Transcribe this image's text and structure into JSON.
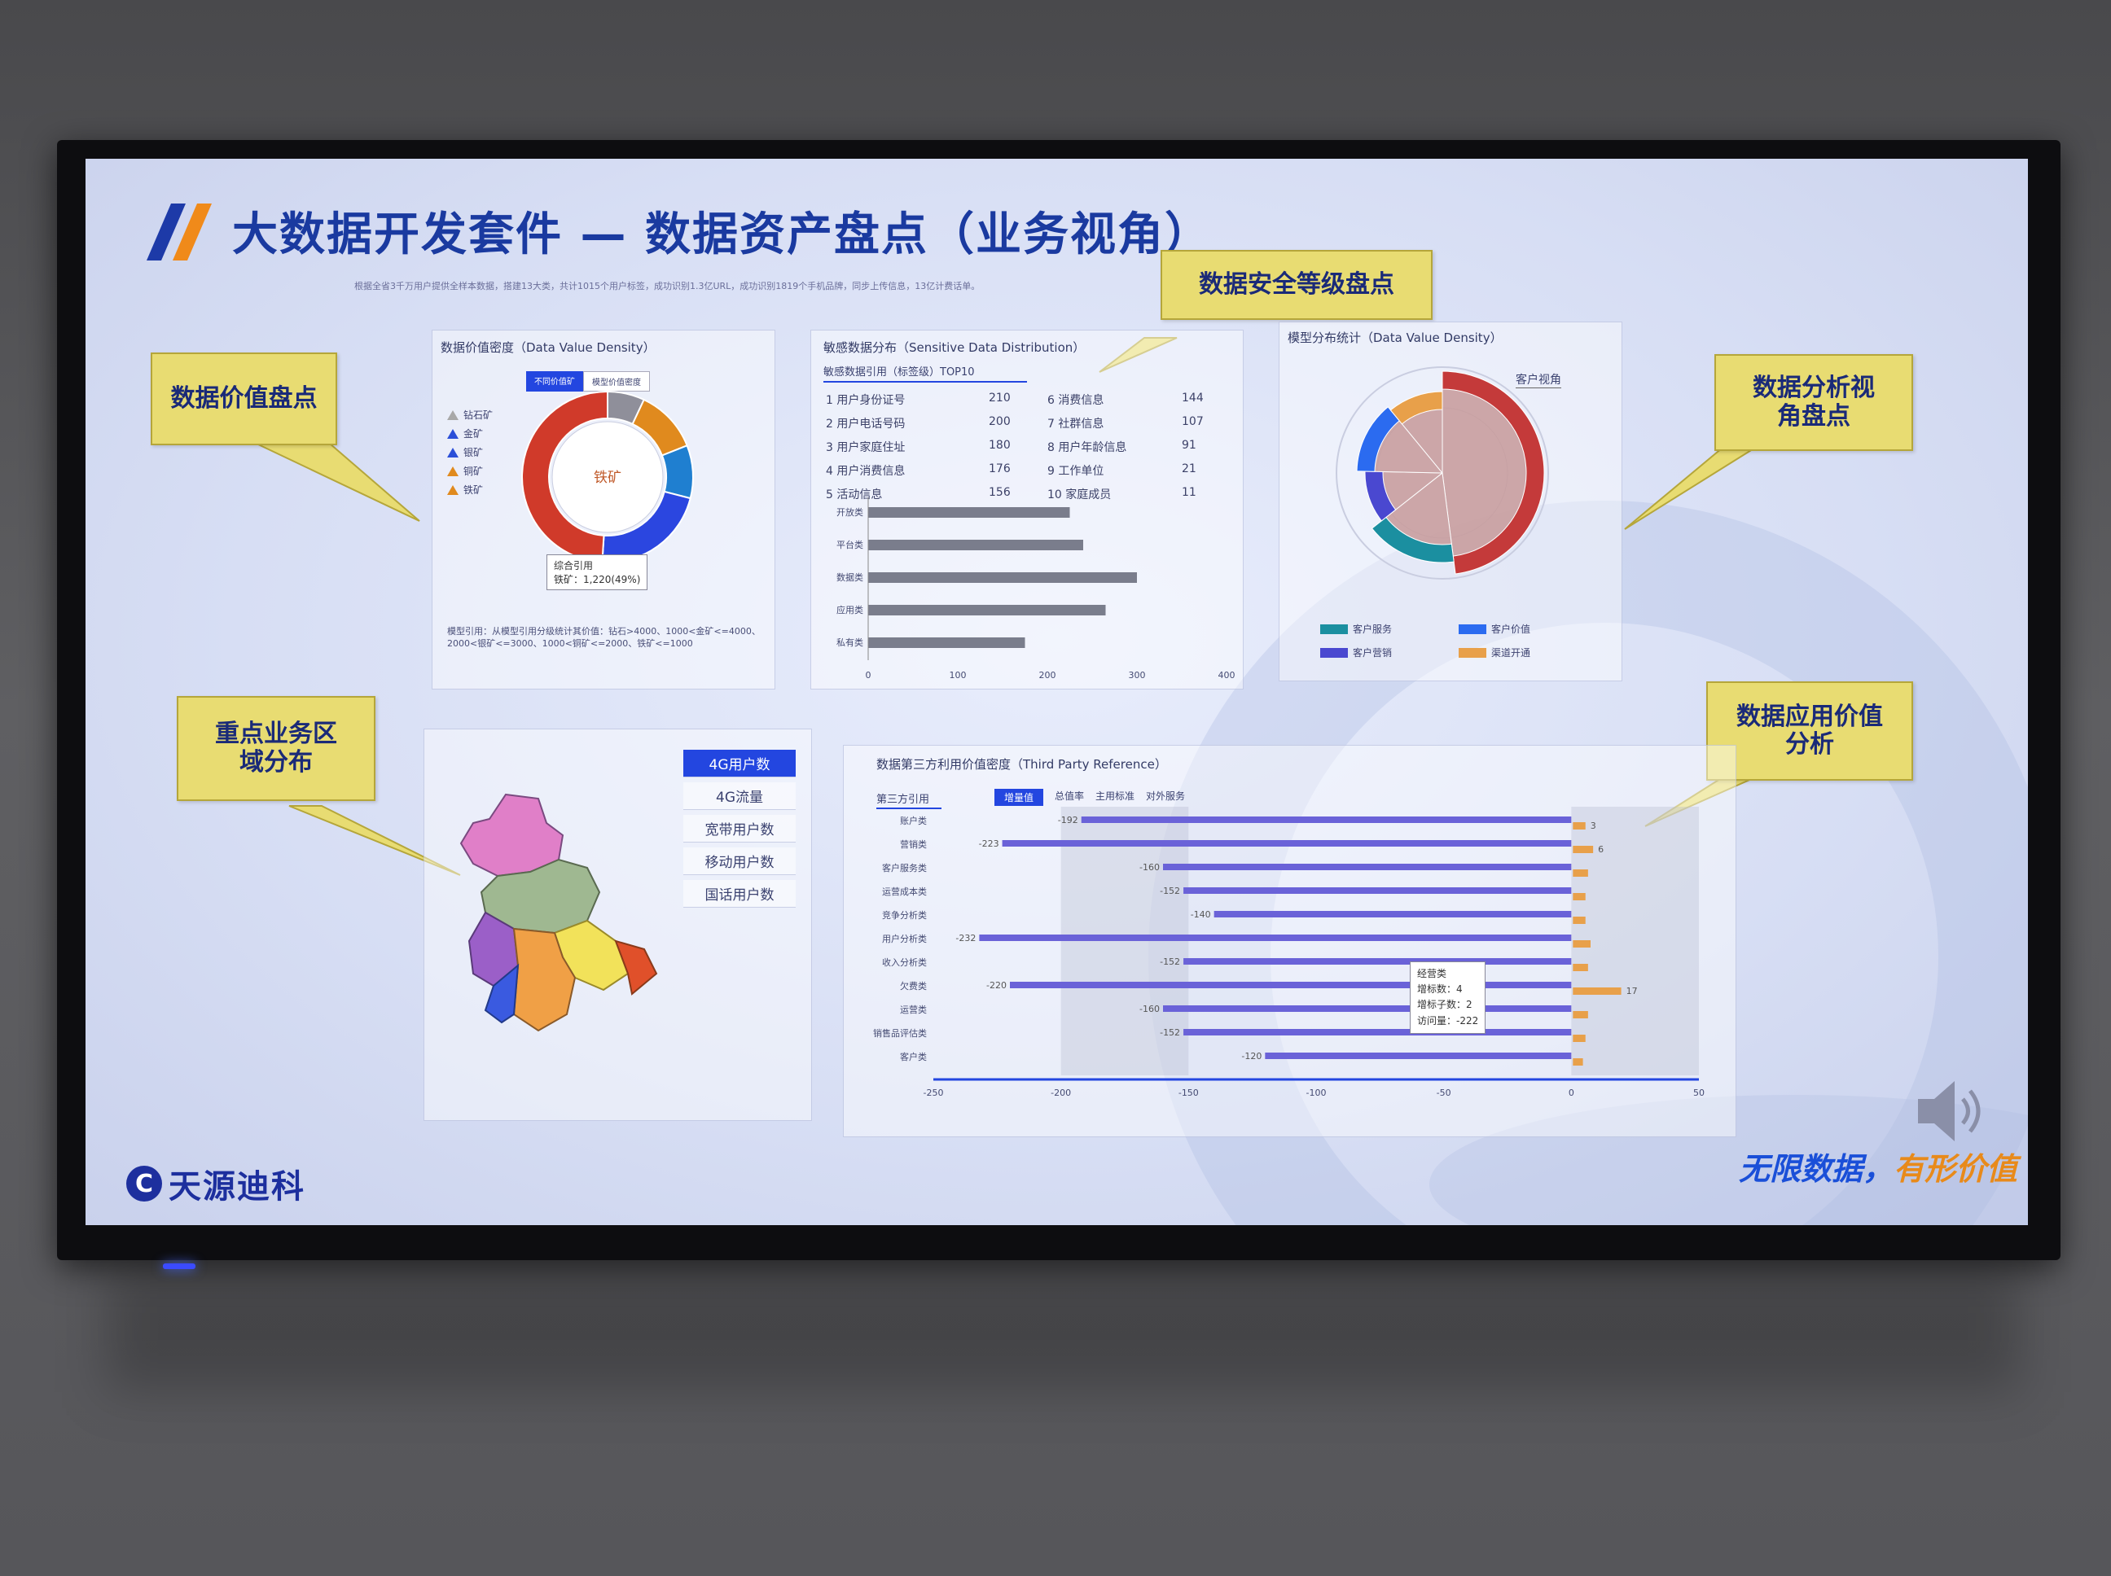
{
  "slide": {
    "title": "大数据开发套件 — 数据资产盘点（业务视角）",
    "subline": "根据全省3千万用户提供全样本数据，搭建13大类，共计1015个用户标签，成功识别1.3亿URL，成功识别1819个手机品牌，同步上传信息，13亿计费话单。"
  },
  "callouts": {
    "value": "数据价值盘点",
    "security": "数据安全等级盘点",
    "analysis": "数据分析视角盘点",
    "region": "重点业务区域分布",
    "application": "数据应用价值分析"
  },
  "density_panel": {
    "title": "数据价值密度（Data Value Density）",
    "toggle_active": "不同价值矿",
    "toggle_inactive": "模型价值密度",
    "legend": [
      {
        "label": "钻石矿",
        "color": "#a8a8a8"
      },
      {
        "label": "金矿",
        "color": "#2b4fd8"
      },
      {
        "label": "银矿",
        "color": "#2b4fd8"
      },
      {
        "label": "铜矿",
        "color": "#e08a1e"
      },
      {
        "label": "铁矿",
        "color": "#e08a1e"
      }
    ],
    "center_label": "铁矿",
    "tooltip_title": "综合引用",
    "tooltip_value": "铁矿：1,220(49%)",
    "footnote": "模型引用：从模型引用分级统计其价值：钻石>4000、1000<金矿<=4000、2000<银矿<=3000、1000<铜矿<=2000、铁矿<=1000"
  },
  "sensitive_panel": {
    "title": "敏感数据分布（Sensitive Data Distribution）",
    "subtab": "敏感数据引用（标签级）TOP10",
    "rows": [
      {
        "name": "1 用户身份证号",
        "value": "210"
      },
      {
        "name": "2 用户电话号码",
        "value": "200"
      },
      {
        "name": "3 用户家庭住址",
        "value": "180"
      },
      {
        "name": "4 用户消费信息",
        "value": "176"
      },
      {
        "name": "5 活动信息",
        "value": "156"
      },
      {
        "name": "6 消费信息",
        "value": "144"
      },
      {
        "name": "7 社群信息",
        "value": "107"
      },
      {
        "name": "8 用户年龄信息",
        "value": "91"
      },
      {
        "name": "9 工作单位",
        "value": "21"
      },
      {
        "name": "10 家庭成员",
        "value": "11"
      }
    ]
  },
  "analysis_panel": {
    "title": "模型分布统计（Data Value Density）",
    "tag": "客户视角",
    "legend": [
      {
        "label": "客户服务",
        "color": "#1b8fa0"
      },
      {
        "label": "客户价值",
        "color": "#2b6bf0"
      },
      {
        "label": "客户营销",
        "color": "#4a48d0"
      },
      {
        "label": "渠道开通",
        "color": "#e8a04a"
      }
    ]
  },
  "region_panel": {
    "menu": [
      "4G用户数",
      "4G流量",
      "宽带用户数",
      "移动用户数",
      "国话用户数"
    ]
  },
  "third_party_panel": {
    "title": "数据第三方利用价值密度（Third Party Reference）",
    "subtab": "第三方引用",
    "tabs": [
      "增量值",
      "总值率",
      "主用标准",
      "对外服务"
    ],
    "tooltip": [
      "经营类",
      "增标数：4",
      "增标子数：2",
      "访问量：-222"
    ]
  },
  "chart_data": [
    {
      "type": "bar",
      "orientation": "horizontal",
      "categories": [
        "开放类",
        "平台类",
        "数据类",
        "应用类",
        "私有类"
      ],
      "values": [
        225,
        240,
        300,
        265,
        175
      ],
      "xlim": [
        0,
        400
      ],
      "xticks": [
        "0",
        "100",
        "200",
        "300",
        "400"
      ]
    },
    {
      "type": "pie",
      "variant": "donut",
      "labels": [
        "钻石矿",
        "金矿",
        "银矿",
        "铜矿",
        "铁矿"
      ],
      "values": [
        7,
        12,
        10,
        22,
        49
      ],
      "colors": [
        "#8f8f9a",
        "#e08a1e",
        "#1f7fd0",
        "#2b46e0",
        "#d03a2a"
      ]
    },
    {
      "type": "pie",
      "variant": "rose",
      "labels": [
        "客户视角",
        "客户服务",
        "客户营销",
        "客户价值",
        "渠道开通"
      ],
      "values": [
        35,
        12,
        8,
        10,
        8
      ],
      "colors": [
        "#c43a3a",
        "#1b8fa0",
        "#4a48d0",
        "#2b6bf0",
        "#e8a04a"
      ]
    },
    {
      "type": "bar",
      "orientation": "horizontal",
      "categories": [
        "账户类",
        "营销类",
        "客户服务类",
        "运营成本类",
        "竞争分析类",
        "用户分析类",
        "收入分析类",
        "欠费类",
        "运营类",
        "销售品评估类",
        "客户类"
      ],
      "series": [
        {
          "values": [
            -192,
            -223,
            -160,
            -152,
            -140,
            -232,
            -152,
            -220,
            -160,
            -152,
            -120
          ]
        },
        {
          "values": [
            3,
            6,
            4,
            3,
            3,
            5,
            4,
            17,
            4,
            3,
            2
          ]
        }
      ],
      "xlim": [
        -250,
        50
      ],
      "xticks": [
        "-250",
        "-200",
        "-150",
        "-100",
        "-50",
        "0",
        "50"
      ],
      "labels_left": [
        "-192",
        "-223",
        "-160",
        "-152",
        "-140",
        "-232",
        "-152",
        "-220",
        "-160",
        "-152",
        "-120"
      ],
      "labels_right": [
        "3",
        "6",
        "",
        "",
        "",
        "",
        "",
        "17",
        "",
        "",
        ""
      ]
    }
  ],
  "footer": {
    "brand_mark": "C",
    "brand": "天源迪科",
    "slogan_part1": "无限数据，",
    "slogan_part2": "有形价值",
    "slogan_color1": "#1a4fd8",
    "slogan_color2": "#e88a1a"
  }
}
